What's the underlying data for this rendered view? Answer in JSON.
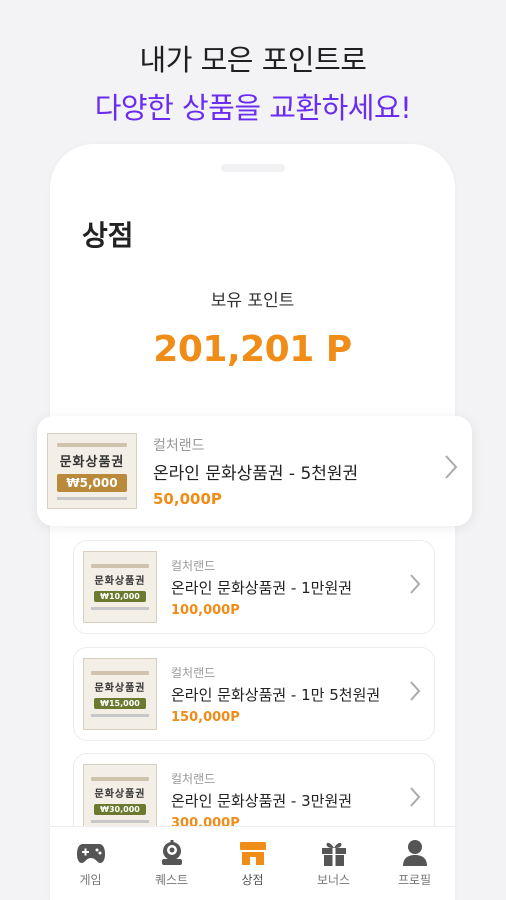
{
  "promo": {
    "line1": "내가 모은 포인트로",
    "line2": "다양한 상품을 교환하세요!"
  },
  "header": {
    "title": "상점"
  },
  "points": {
    "label": "보유 포인트",
    "value": "201,201 P"
  },
  "products": [
    {
      "brand": "컬처랜드",
      "name": "온라인 문화상품권 - 5천원권",
      "price": "50,000P",
      "thumb_title": "문화상품권",
      "thumb_amount": "₩5,000"
    },
    {
      "brand": "컬처랜드",
      "name": "온라인 문화상품권 - 1만원권",
      "price": "100,000P",
      "thumb_title": "문화상품권",
      "thumb_amount": "₩10,000"
    },
    {
      "brand": "컬처랜드",
      "name": "온라인 문화상품권 - 1만 5천원권",
      "price": "150,000P",
      "thumb_title": "문화상품권",
      "thumb_amount": "₩15,000"
    },
    {
      "brand": "컬처랜드",
      "name": "온라인 문화상품권 - 3만원권",
      "price": "300,000P",
      "thumb_title": "문화상품권",
      "thumb_amount": "₩30,000"
    }
  ],
  "tabs": [
    {
      "label": "게임",
      "icon": "gamepad-icon"
    },
    {
      "label": "퀘스트",
      "icon": "robot-icon"
    },
    {
      "label": "상점",
      "icon": "store-icon",
      "active": true
    },
    {
      "label": "보너스",
      "icon": "gift-icon"
    },
    {
      "label": "프로필",
      "icon": "person-icon"
    }
  ],
  "colors": {
    "accent": "#f08c18",
    "promo_purple": "#6a2cf0",
    "tab_inactive": "#777777"
  }
}
